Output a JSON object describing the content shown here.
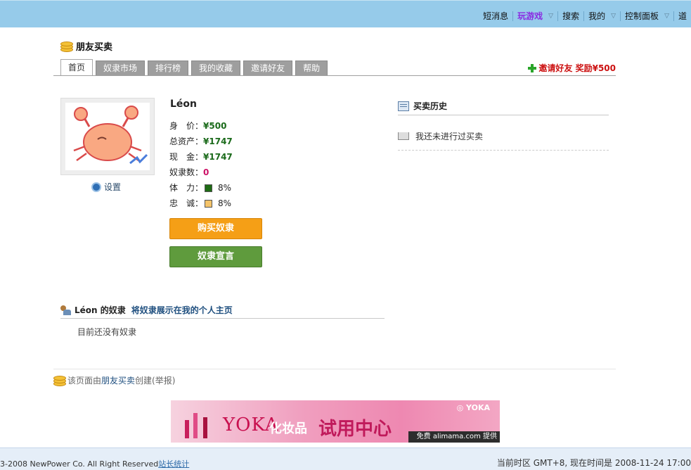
{
  "top_nav": {
    "items": [
      {
        "label": "短消息",
        "dropdown": false
      },
      {
        "label": "玩游戏",
        "dropdown": true,
        "active": true
      },
      {
        "label": "搜索",
        "dropdown": false
      },
      {
        "label": "我的",
        "dropdown": true
      },
      {
        "label": "控制面板",
        "dropdown": true
      },
      {
        "label": "道",
        "dropdown": false
      }
    ]
  },
  "app": {
    "title": "朋友买卖"
  },
  "tabs": [
    {
      "label": "首页",
      "active": true
    },
    {
      "label": "奴隶市场"
    },
    {
      "label": "排行榜"
    },
    {
      "label": "我的收藏"
    },
    {
      "label": "邀请好友"
    },
    {
      "label": "帮助"
    }
  ],
  "invite_reward": "邀请好友 奖励¥500",
  "profile": {
    "username": "Léon",
    "settings_label": "设置",
    "stats": [
      {
        "label": "身　价：",
        "value": "¥500"
      },
      {
        "label": "总资产：",
        "value": "¥1747"
      },
      {
        "label": "现　金：",
        "value": "¥1747"
      },
      {
        "label": "奴隶数：",
        "value": "0"
      },
      {
        "label": "体　力：",
        "value": "8%",
        "color": "#1e6b14"
      },
      {
        "label": "忠　诚：",
        "value": "8%",
        "color": "#f5c46a"
      }
    ],
    "buy_button": "购买奴隶",
    "declaration_button": "奴隶宣言"
  },
  "history": {
    "title": "买卖历史",
    "empty_text": "我还未进行过买卖"
  },
  "slaves": {
    "title": "Léon 的奴隶",
    "link": "将奴隶展示在我的个人主页",
    "empty_text": "目前还没有奴隶"
  },
  "created_by": {
    "prefix": "该页面由",
    "link": "朋友买卖",
    "suffix": "创建(举报)"
  },
  "banner": {
    "yoka": "YOKA",
    "cn_small": "化妆品",
    "headline": "试用中心",
    "logo": "◎ YOKA",
    "bar": "免费 alimama.com 提供"
  },
  "footer": {
    "copyright": "3-2008 NewPower Co. All Right Reserved",
    "stats_link": "站长统计",
    "timezone": "当前时区  GMT+8, 现在时间是  2008-11-24 17:00"
  },
  "colors": {
    "topbar": "#96cbea",
    "buy_button": "#f59f16",
    "declaration_button": "#5f9b3d",
    "invite": "#cc1111"
  }
}
